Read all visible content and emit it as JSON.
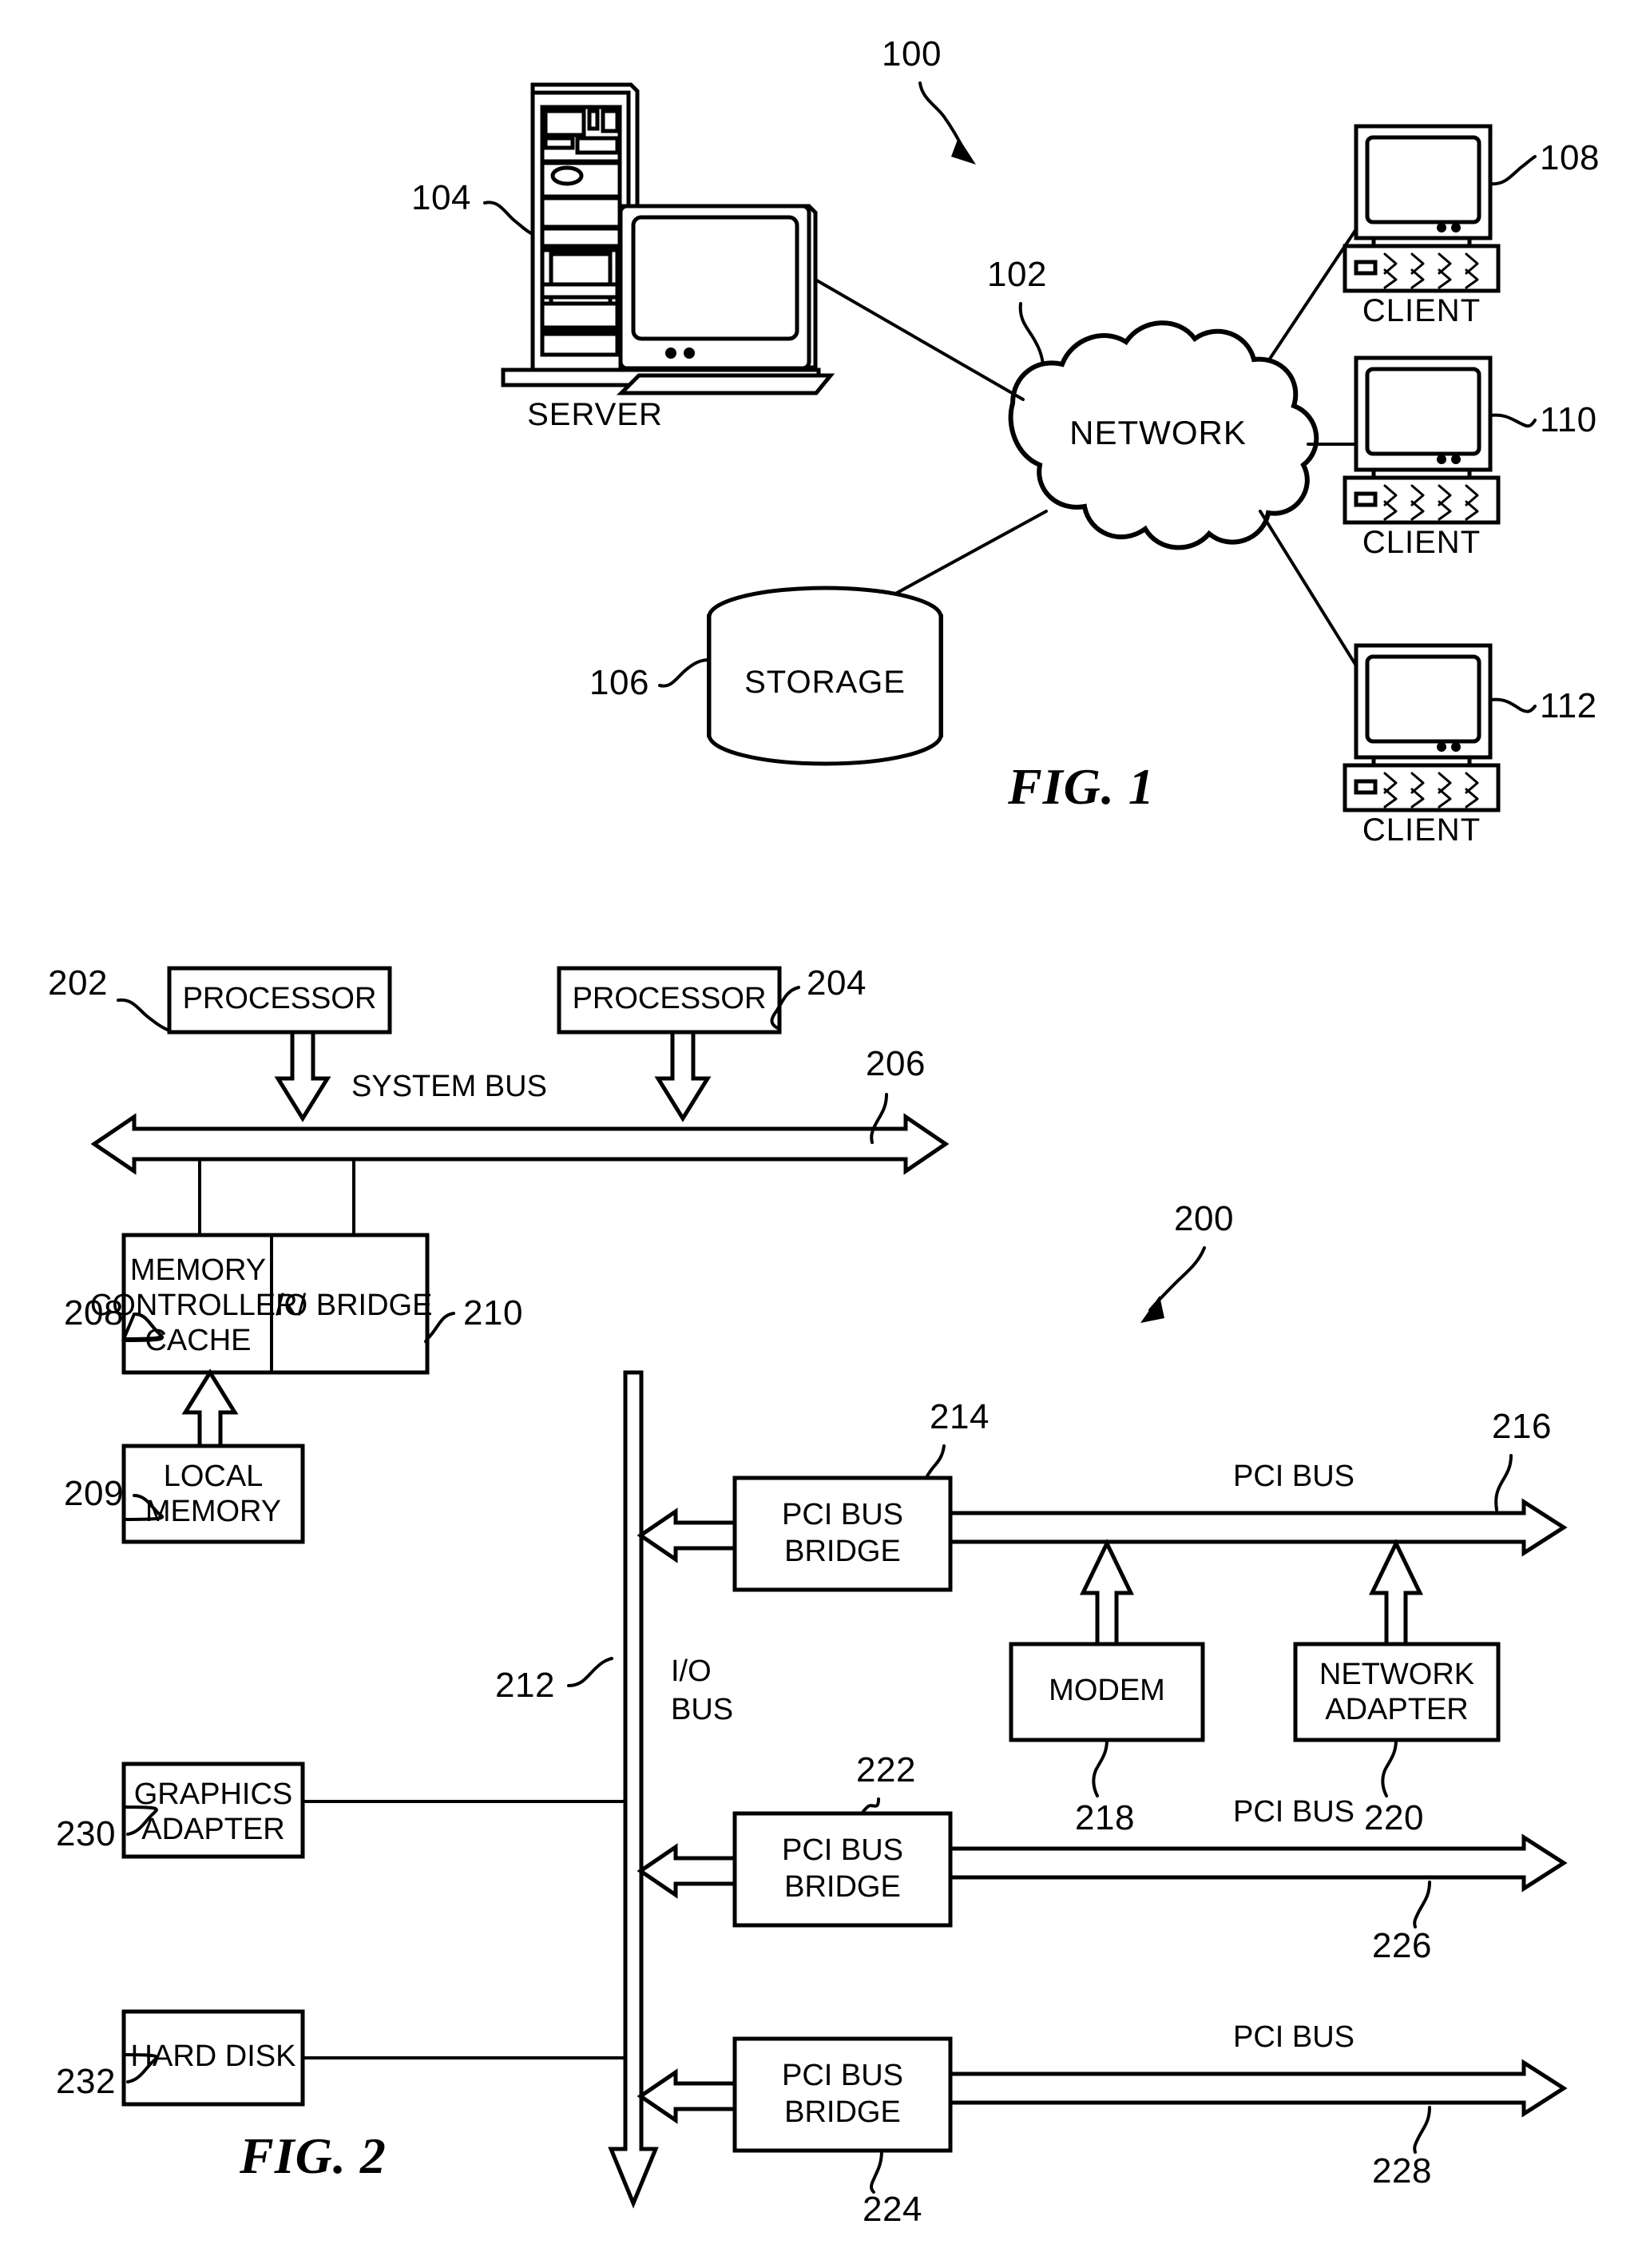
{
  "figure1": {
    "title": "FIG. 1",
    "system_ref": "100",
    "nodes": {
      "server": {
        "label": "SERVER",
        "ref": "104"
      },
      "network": {
        "label": "NETWORK",
        "ref": "102"
      },
      "storage": {
        "label": "STORAGE",
        "ref": "106"
      },
      "client1": {
        "label": "CLIENT",
        "ref": "108"
      },
      "client2": {
        "label": "CLIENT",
        "ref": "110"
      },
      "client3": {
        "label": "CLIENT",
        "ref": "112"
      }
    }
  },
  "figure2": {
    "title": "FIG. 2",
    "system_ref": "200",
    "blocks": {
      "processor_left": {
        "label": "PROCESSOR",
        "ref": "202"
      },
      "processor_right": {
        "label": "PROCESSOR",
        "ref": "204"
      },
      "memory_controller": {
        "label_line1": "MEMORY",
        "label_line2": "CONTROLLER/",
        "label_line3": "CACHE",
        "ref": "208"
      },
      "io_bridge": {
        "label": "I/O BRIDGE",
        "ref": "210"
      },
      "local_memory": {
        "label_line1": "LOCAL",
        "label_line2": "MEMORY",
        "ref": "209"
      },
      "pci_bus_bridge_1": {
        "label_line1": "PCI BUS",
        "label_line2": "BRIDGE",
        "ref": "214"
      },
      "modem": {
        "label": "MODEM",
        "ref": "218"
      },
      "network_adapter": {
        "label_line1": "NETWORK",
        "label_line2": "ADAPTER",
        "ref": "220"
      },
      "pci_bus_bridge_2": {
        "label_line1": "PCI BUS",
        "label_line2": "BRIDGE",
        "ref": "222"
      },
      "pci_bus_bridge_3": {
        "label_line1": "PCI BUS",
        "label_line2": "BRIDGE",
        "ref": "224"
      },
      "graphics_adapter": {
        "label_line1": "GRAPHICS",
        "label_line2": "ADAPTER",
        "ref": "230"
      },
      "hard_disk": {
        "label": "HARD DISK",
        "ref": "232"
      }
    },
    "buses": {
      "system_bus": {
        "label": "SYSTEM BUS",
        "ref": "206"
      },
      "io_bus": {
        "label_line1": "I/O",
        "label_line2": "BUS",
        "ref": "212"
      },
      "pci_bus_1": {
        "label": "PCI BUS",
        "ref": "216"
      },
      "pci_bus_2": {
        "label": "PCI BUS",
        "ref": "226"
      },
      "pci_bus_3": {
        "label": "PCI BUS",
        "ref": "228"
      }
    }
  }
}
